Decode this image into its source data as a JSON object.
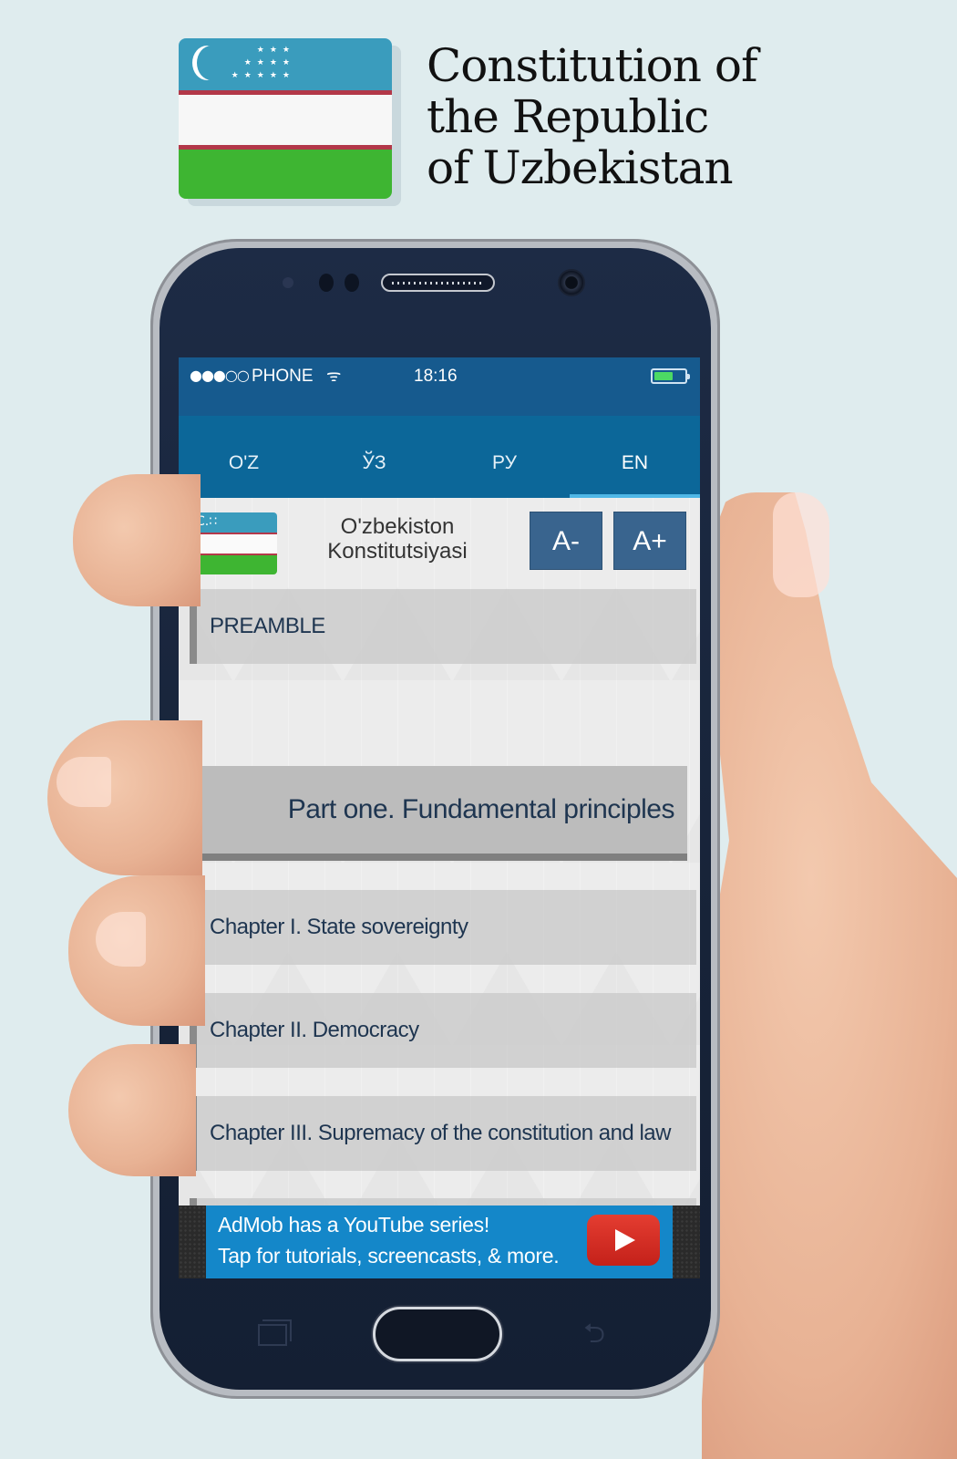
{
  "promo": {
    "title_lines": [
      "Constitution of",
      "the Republic",
      "of Uzbekistan"
    ],
    "flag_icon": "uzbekistan-flag-icon"
  },
  "status_bar": {
    "signal": "●●●○○",
    "carrier": "PHONE",
    "wifi_icon": "wifi-icon",
    "time": "18:16",
    "battery_level": 0.55,
    "battery_color": "#4cd964"
  },
  "tabs": [
    {
      "label": "O'Z",
      "active": false
    },
    {
      "label": "ЎЗ",
      "active": false
    },
    {
      "label": "РУ",
      "active": false
    },
    {
      "label": "EN",
      "active": true
    }
  ],
  "app_header": {
    "title_line1": "O'zbekiston",
    "title_line2": "Konstitutsiyasi",
    "decrease_font_label": "A-",
    "increase_font_label": "A+",
    "flag_symbol": "C.∷"
  },
  "contents": {
    "preamble": "PREAMBLE",
    "part_one": "Part one. Fundamental principles",
    "chapters": [
      "Chapter I. State sovereignty",
      "Chapter II. Democracy",
      "Chapter III. Supremacy of the constitution and law"
    ]
  },
  "ad": {
    "line1": "AdMob has a YouTube series!",
    "line2": "Tap for tutorials, screencasts, & more.",
    "icon": "youtube-play-icon"
  },
  "nav_keys": {
    "back_glyph": "⮌"
  },
  "colors": {
    "tab_bar": "#0c6799",
    "status_bar": "#165a8e",
    "tab_indicator": "#4fb7e6",
    "font_button": "#39648e",
    "ad_background": "#1487c9",
    "background": "#dfecee",
    "text_dark": "#1e3550"
  }
}
